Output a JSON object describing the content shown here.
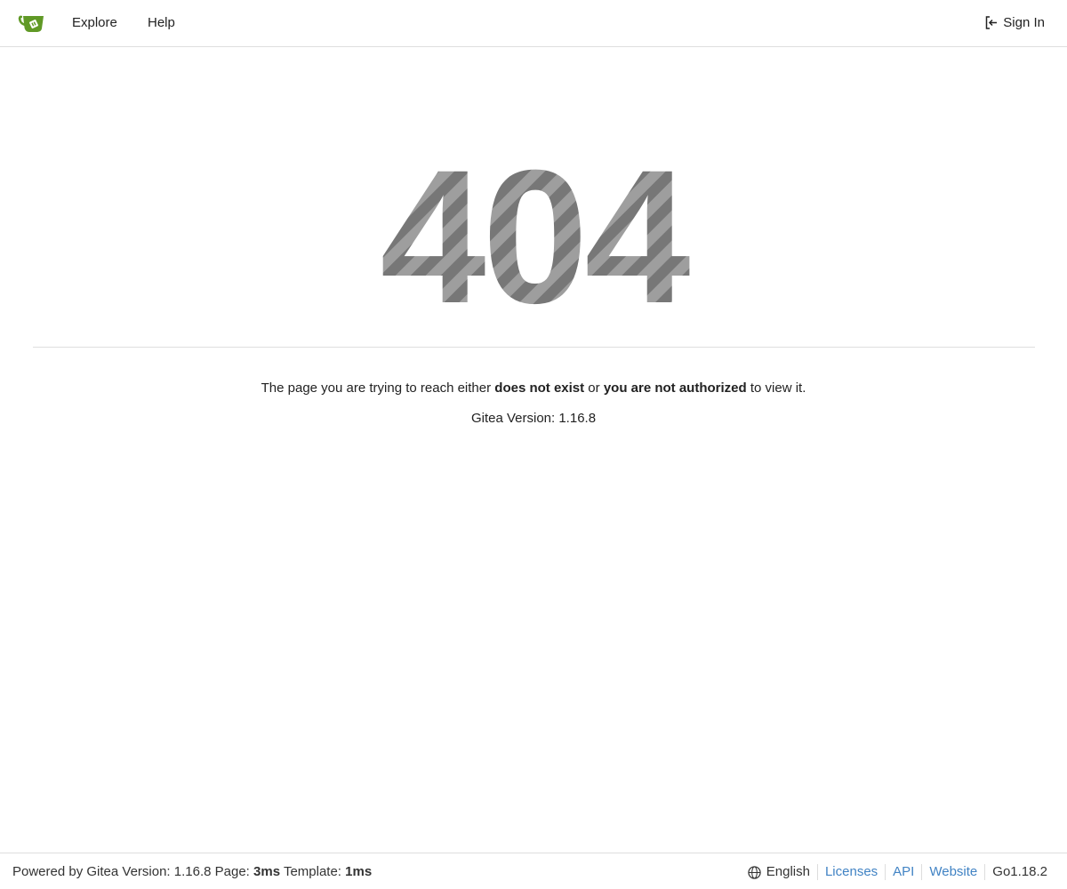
{
  "navbar": {
    "logo_icon": "gitea-teacup-icon",
    "brand_color": "#609926",
    "explore": "Explore",
    "help": "Help",
    "sign_in": "Sign In",
    "sign_in_icon": "sign-in-icon"
  },
  "error": {
    "code": "404",
    "message_pre": "The page you are trying to reach either ",
    "message_bold1": "does not exist",
    "message_mid": " or ",
    "message_bold2": "you are not authorized",
    "message_post": " to view it.",
    "version": "Gitea Version: 1.16.8"
  },
  "footer": {
    "powered": "Powered by Gitea Version: 1.16.8 Page: ",
    "page_time": "3ms",
    "template_label": " Template: ",
    "template_time": "1ms",
    "language": "English",
    "language_icon": "globe-icon",
    "licenses": "Licenses",
    "api": "API",
    "website": "Website",
    "go_version": "Go1.18.2",
    "link_color": "#4183c4"
  }
}
